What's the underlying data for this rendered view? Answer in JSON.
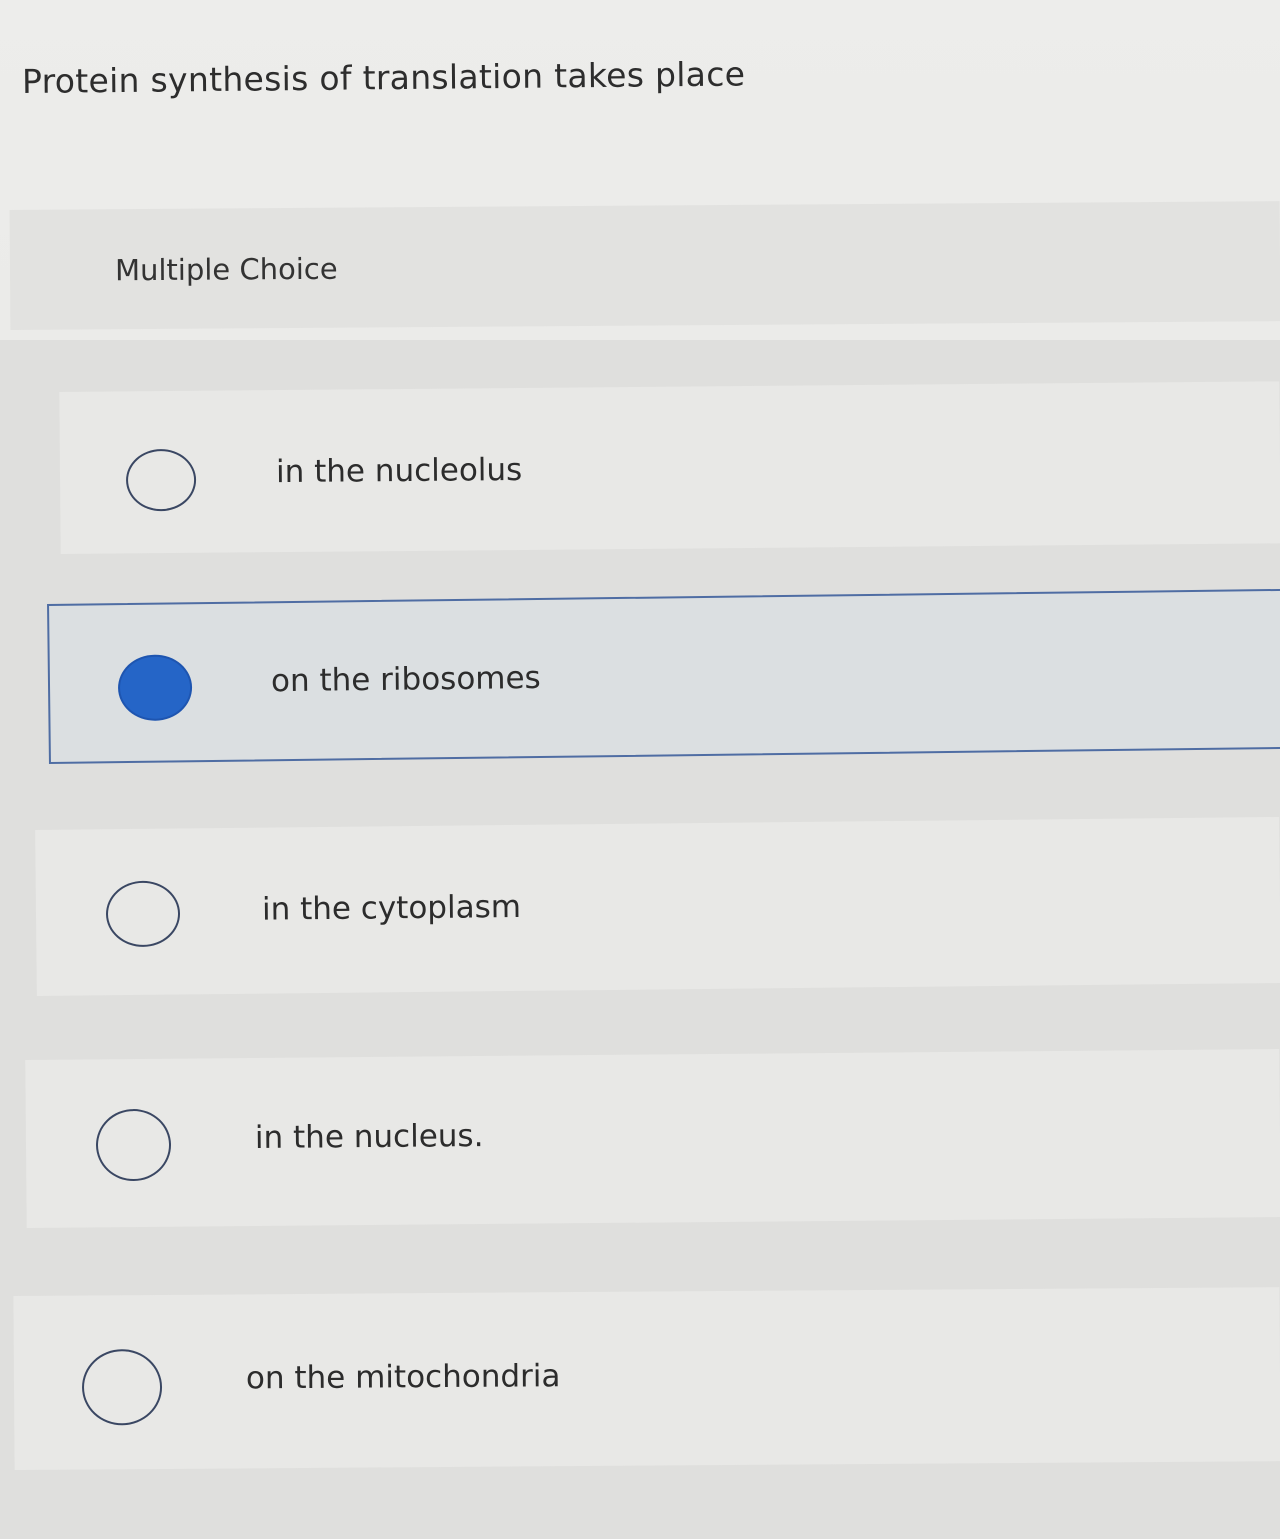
{
  "question": {
    "text": "Protein synthesis of translation takes place"
  },
  "section": {
    "label": "Multiple Choice"
  },
  "options": [
    {
      "text": "in the nucleolus",
      "selected": false
    },
    {
      "text": "on the ribosomes",
      "selected": true
    },
    {
      "text": "in the cytoplasm",
      "selected": false
    },
    {
      "text": "in the nucleus.",
      "selected": false
    },
    {
      "text": "on the mitochondria",
      "selected": false
    }
  ],
  "colors": {
    "selected_fill": "#2565c7",
    "selected_border": "#4f6da3"
  }
}
